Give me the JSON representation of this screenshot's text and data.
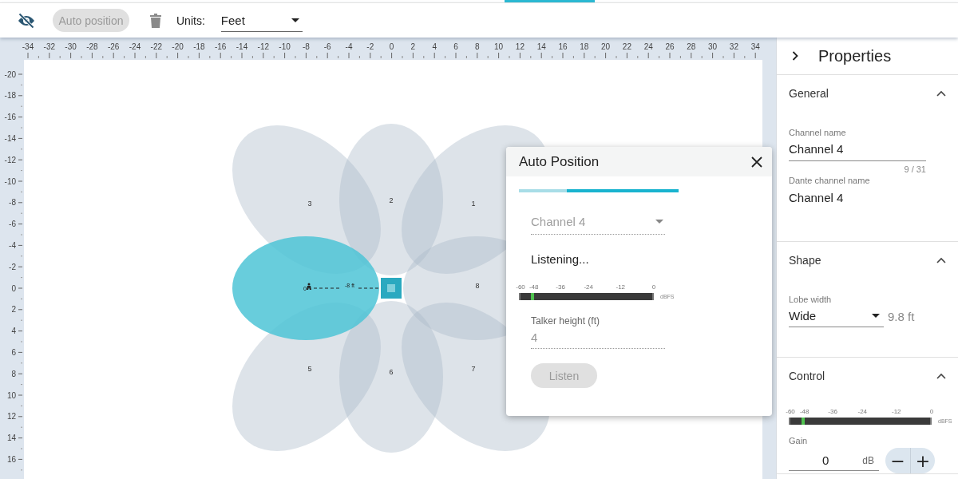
{
  "toolbar": {
    "auto_position_button": {
      "label": "Auto position",
      "disabled": true
    },
    "units_label": "Units:",
    "units_select": {
      "value": "Feet"
    }
  },
  "canvas": {
    "x_ruler": [
      "-34",
      "-32",
      "-30",
      "-28",
      "-26",
      "-24",
      "-22",
      "-20",
      "-18",
      "-16",
      "-14",
      "-12",
      "-10",
      "-8",
      "-6",
      "-4",
      "-2",
      "0",
      "2",
      "4",
      "6",
      "8",
      "10",
      "12",
      "14",
      "16",
      "18",
      "20",
      "22",
      "24",
      "26",
      "28",
      "30",
      "32",
      "34"
    ],
    "y_ruler": [
      "-20",
      "-18",
      "-16",
      "-14",
      "-12",
      "-10",
      "-8",
      "-6",
      "-4",
      "-2",
      "0",
      "2",
      "4",
      "6",
      "8",
      "10",
      "12",
      "14",
      "16"
    ],
    "lobes": [
      {
        "label": "3",
        "selected": false
      },
      {
        "label": "2",
        "selected": false
      },
      {
        "label": "1",
        "selected": false
      },
      {
        "selected": true
      },
      {
        "label": "8",
        "selected": false
      },
      {
        "label": "5",
        "selected": false
      },
      {
        "label": "6",
        "selected": false
      },
      {
        "label": "7",
        "selected": false
      }
    ],
    "talker_label": "0",
    "distance_label": "-8 ft"
  },
  "dialog": {
    "title": "Auto Position",
    "progress": {
      "level": 0.7
    },
    "channel_select": {
      "value": "Channel 4",
      "disabled": true
    },
    "status": "Listening...",
    "meter": {
      "scale": [
        "-60",
        "-48",
        "-36",
        "-24",
        "-12",
        "0"
      ],
      "unit": "dBFS",
      "level": 0.08
    },
    "talker_height": {
      "label": "Talker height (ft)",
      "value": "4"
    },
    "listen_button": {
      "label": "Listen",
      "disabled": true
    }
  },
  "properties": {
    "title": "Properties",
    "sections": [
      {
        "kind": "general",
        "title": "General",
        "expanded": true,
        "channel_name": {
          "label": "Channel name",
          "value": "Channel 4",
          "counter": "9 / 31"
        },
        "dante_channel_name": {
          "label": "Dante channel name",
          "value": "Channel 4"
        }
      },
      {
        "kind": "shape",
        "title": "Shape",
        "expanded": true,
        "lobe_width": {
          "label": "Lobe width",
          "value": "Wide",
          "reading": "9.8 ft"
        }
      },
      {
        "kind": "control",
        "title": "Control",
        "expanded": true,
        "meter": {
          "scale": [
            "-60",
            "-48",
            "-36",
            "-24",
            "-12",
            "0"
          ],
          "unit": "dBFS",
          "level": 0.08
        },
        "gain": {
          "label": "Gain",
          "value": "0",
          "unit": "dB",
          "buttons": [
            "−",
            "+"
          ]
        }
      }
    ]
  }
}
